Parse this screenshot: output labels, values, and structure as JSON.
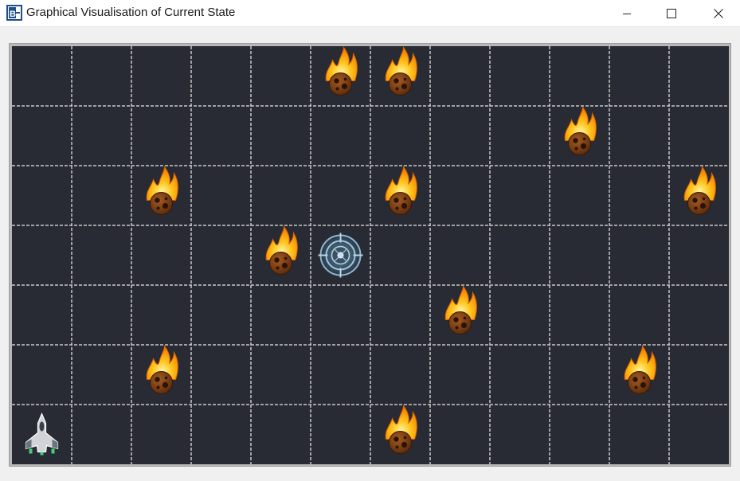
{
  "window": {
    "title": "Graphical Visualisation of Current State",
    "app_icon_letters": "B"
  },
  "controls": {
    "minimize_icon": "minimize-icon",
    "maximize_icon": "maximize-icon",
    "close_icon": "close-icon"
  },
  "board": {
    "columns": 12,
    "rows": 7,
    "background_color": "#282b33",
    "grid_line_color": "#c8c8c8",
    "meteors": [
      {
        "col": 5,
        "row": 0
      },
      {
        "col": 6,
        "row": 0
      },
      {
        "col": 9,
        "row": 1
      },
      {
        "col": 2,
        "row": 2
      },
      {
        "col": 6,
        "row": 2
      },
      {
        "col": 11,
        "row": 2
      },
      {
        "col": 4,
        "row": 3
      },
      {
        "col": 7,
        "row": 4
      },
      {
        "col": 2,
        "row": 5
      },
      {
        "col": 10,
        "row": 5
      },
      {
        "col": 6,
        "row": 6
      }
    ],
    "target": {
      "col": 5,
      "row": 3,
      "icon": "crosshair-target-icon"
    },
    "ship": {
      "col": 0,
      "row": 6,
      "icon": "spaceship-icon"
    }
  }
}
